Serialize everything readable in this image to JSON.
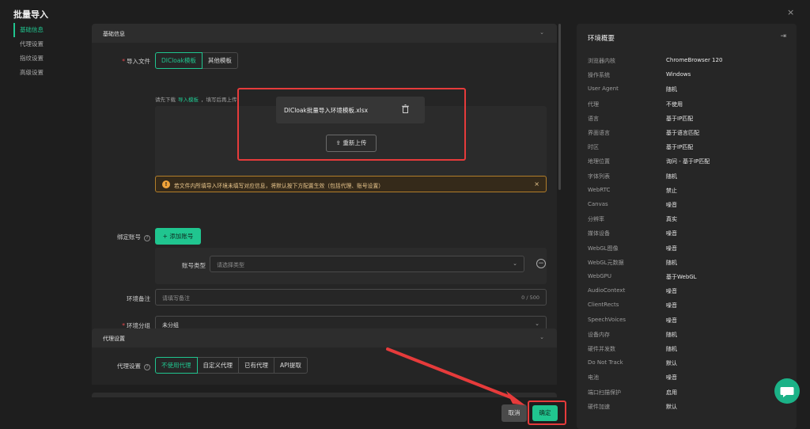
{
  "dialog": {
    "title": "批量导入",
    "close": "×"
  },
  "nav": [
    {
      "label": "基础信息"
    },
    {
      "label": "代理设置"
    },
    {
      "label": "指纹设置"
    },
    {
      "label": "高级设置"
    }
  ],
  "basic": {
    "section_title": "基础信息",
    "import_label": "导入文件",
    "template_tabs": [
      "DICloak模板",
      "其他模板"
    ],
    "hint_prefix": "请先下载",
    "hint_link": "导入模板",
    "hint_suffix": "，填写后再上传",
    "file_name": "DICloak批量导入环境模板.xlsx",
    "reupload": "重新上传",
    "warning": "若文件内所填导入环境未填写对应信息，将默认按下方配置生效（包括代理、账号设置）",
    "bind_account_label": "绑定账号",
    "add_account": "+ 添加账号",
    "account_type_label": "账号类型",
    "account_type_placeholder": "请选择类型",
    "remark_label": "环境备注",
    "remark_placeholder": "请填写备注",
    "remark_counter": "0 / 500",
    "group_label": "环境分组",
    "group_value": "未分组"
  },
  "proxy": {
    "section_title": "代理设置",
    "label": "代理设置",
    "options": [
      "不使用代理",
      "自定义代理",
      "已有代理",
      "API提取"
    ]
  },
  "summary": {
    "title": "环境概要",
    "rows": [
      {
        "k": "浏览器内核",
        "v": "ChromeBrowser 120"
      },
      {
        "k": "操作系统",
        "v": "Windows"
      },
      {
        "k": "User Agent",
        "v": "随机"
      },
      {
        "k": "代理",
        "v": "不使用"
      },
      {
        "k": "语言",
        "v": "基于IP匹配"
      },
      {
        "k": "界面语言",
        "v": "基于语言匹配"
      },
      {
        "k": "时区",
        "v": "基于IP匹配"
      },
      {
        "k": "地理位置",
        "v": "询问 - 基于IP匹配"
      },
      {
        "k": "字体列表",
        "v": "随机"
      },
      {
        "k": "WebRTC",
        "v": "禁止"
      },
      {
        "k": "Canvas",
        "v": "噪音"
      },
      {
        "k": "分辨率",
        "v": "真实"
      },
      {
        "k": "媒体设备",
        "v": "噪音"
      },
      {
        "k": "WebGL图像",
        "v": "噪音"
      },
      {
        "k": "WebGL元数据",
        "v": "随机"
      },
      {
        "k": "WebGPU",
        "v": "基于WebGL"
      },
      {
        "k": "AudioContext",
        "v": "噪音"
      },
      {
        "k": "ClientRects",
        "v": "噪音"
      },
      {
        "k": "SpeechVoices",
        "v": "噪音"
      },
      {
        "k": "设备内存",
        "v": "随机"
      },
      {
        "k": "硬件并发数",
        "v": "随机"
      },
      {
        "k": "Do Not Track",
        "v": "默认"
      },
      {
        "k": "电池",
        "v": "噪音"
      },
      {
        "k": "端口扫描保护",
        "v": "启用"
      },
      {
        "k": "硬件加速",
        "v": "默认"
      }
    ]
  },
  "footer": {
    "cancel": "取消",
    "ok": "确定"
  },
  "colors": {
    "accent": "#20c58f",
    "highlight": "#e63b3b",
    "warning": "#f0a33a"
  }
}
